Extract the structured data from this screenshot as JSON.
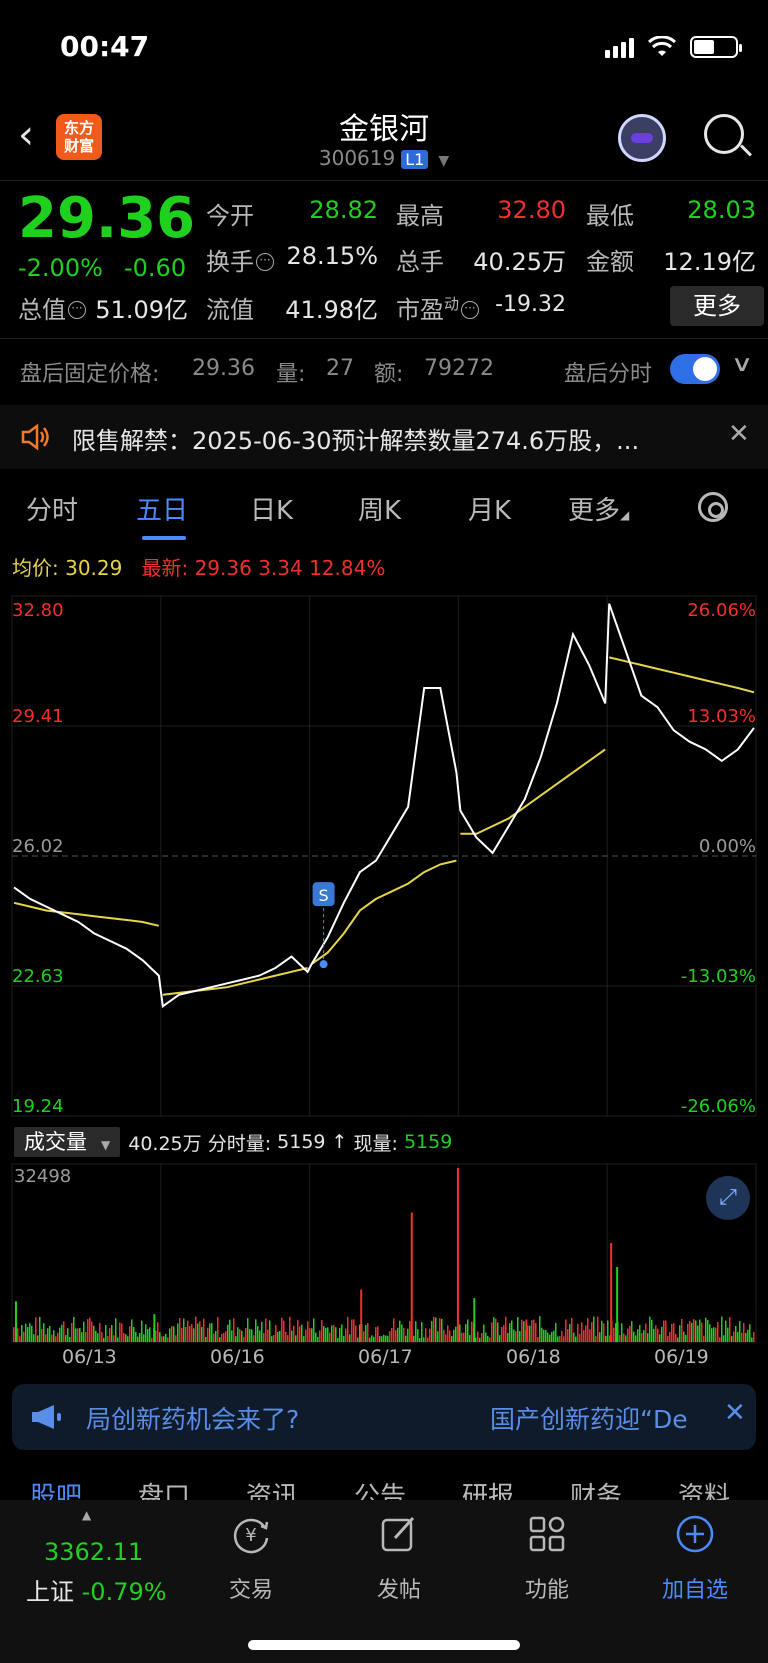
{
  "status_bar": {
    "time": "00:47"
  },
  "header": {
    "stock_name": "金银河",
    "stock_code": "300619",
    "level_badge": "L1"
  },
  "quote": {
    "price": "29.36",
    "change_pct": "-2.00%",
    "change": "-0.60",
    "open_label": "今开",
    "open": "28.82",
    "high_label": "最高",
    "high": "32.80",
    "low_label": "最低",
    "low": "28.03",
    "turnover_label": "换手",
    "turnover": "28.15%",
    "volume_label": "总手",
    "volume": "40.25万",
    "amount_label": "金额",
    "amount": "12.19亿",
    "mktcap_label": "总值",
    "mktcap": "51.09亿",
    "float_label": "流值",
    "float_cap": "41.98亿",
    "pe_label": "市盈",
    "pe_sup": "动",
    "pe": "-19.32",
    "more_label": "更多"
  },
  "after_hours": {
    "label": "盘后固定价格:",
    "price": "29.36",
    "vol_label": "量:",
    "vol": "27",
    "amt_label": "额:",
    "amt": "79272",
    "intraday_label": "盘后分时"
  },
  "notice": {
    "text": "限售解禁：2025-06-30预计解禁数量274.6万股，..."
  },
  "tabs": [
    "分时",
    "五日",
    "日K",
    "周K",
    "月K",
    "更多"
  ],
  "active_tab": "五日",
  "legend": {
    "avg_label": "均价:",
    "avg": "30.29",
    "latest_label": "最新:",
    "latest": "29.36",
    "latest_change": "3.34",
    "latest_pct": "12.84%"
  },
  "colors": {
    "up": "#f0302c",
    "down": "#1fd01f",
    "accent": "#4a8cff",
    "avg_line": "#e8d44a"
  },
  "chart_data": {
    "type": "line",
    "title": "",
    "xlabel": "",
    "ylabel": "",
    "x": [
      "06/13",
      "06/16",
      "06/17",
      "06/18",
      "06/19"
    ],
    "y_ticks_left": [
      "32.80",
      "29.41",
      "26.02",
      "22.63",
      "19.24"
    ],
    "y_ticks_right": [
      "26.06%",
      "13.03%",
      "0.00%",
      "-13.03%",
      "-26.06%"
    ],
    "ylim": [
      19.24,
      32.8
    ],
    "prev_close": 26.02,
    "series": [
      {
        "values": [
          [
            25.2,
            24.9,
            24.7,
            24.5,
            24.3,
            24.0,
            23.8,
            23.6,
            23.3,
            22.9
          ],
          [
            22.1,
            22.4,
            22.5,
            22.6,
            22.7,
            22.8,
            22.9,
            23.1,
            23.4,
            23.0
          ],
          [
            23.2,
            23.9,
            24.8,
            25.6,
            25.9,
            26.6,
            27.3,
            30.4,
            30.4,
            28.2
          ],
          [
            27.2,
            26.5,
            26.1,
            26.8,
            27.5,
            28.6,
            30.0,
            31.8,
            31.0,
            30.0
          ],
          [
            32.6,
            31.4,
            30.2,
            29.9,
            29.3,
            29.0,
            28.8,
            28.5,
            28.8,
            29.36
          ]
        ]
      },
      {
        "values": [
          [
            24.8,
            24.7,
            24.6,
            24.55,
            24.5,
            24.45,
            24.4,
            24.35,
            24.3,
            24.2
          ],
          [
            22.4,
            22.45,
            22.5,
            22.55,
            22.6,
            22.7,
            22.8,
            22.9,
            23.0,
            23.1
          ],
          [
            23.2,
            23.5,
            24.0,
            24.6,
            24.9,
            25.1,
            25.3,
            25.6,
            25.8,
            25.9
          ],
          [
            26.6,
            26.6,
            26.8,
            27.0,
            27.3,
            27.6,
            27.9,
            28.2,
            28.5,
            28.8
          ],
          [
            31.2,
            31.1,
            31.0,
            30.9,
            30.8,
            30.7,
            30.6,
            30.5,
            30.4,
            30.29
          ]
        ]
      }
    ],
    "volume": {
      "label": "成交量",
      "total": "40.25万",
      "minute_label": "分时量:",
      "minute_value": "5159",
      "arrow": "↑",
      "current_label": "现量:",
      "current_value": "5159",
      "y_max_label": "32498",
      "y_max": 32498,
      "peaks": [
        {
          "day": 0,
          "pos": 0.02,
          "value": 7600,
          "dir": "down"
        },
        {
          "day": 0,
          "pos": 0.95,
          "value": 5200,
          "dir": "down"
        },
        {
          "day": 2,
          "pos": 0.34,
          "value": 9800,
          "dir": "up"
        },
        {
          "day": 2,
          "pos": 0.68,
          "value": 24200,
          "dir": "up"
        },
        {
          "day": 2,
          "pos": 0.99,
          "value": 32498,
          "dir": "up"
        },
        {
          "day": 3,
          "pos": 0.1,
          "value": 8200,
          "dir": "down"
        },
        {
          "day": 3,
          "pos": 0.45,
          "value": 4200,
          "dir": "up"
        },
        {
          "day": 4,
          "pos": 0.02,
          "value": 18500,
          "dir": "up"
        },
        {
          "day": 4,
          "pos": 0.06,
          "value": 14000,
          "dir": "down"
        }
      ]
    }
  },
  "banner": {
    "text": "局创新药机会来了?",
    "text2": "国产创新药迎“De"
  },
  "sub_tabs": [
    "股吧",
    "盘口",
    "资讯",
    "公告",
    "研报",
    "财务",
    "资料"
  ],
  "bottom_bar": {
    "index_value": "3362.11",
    "index_name": "上证",
    "index_pct": "-0.79%",
    "items": [
      {
        "label": "交易",
        "icon": "trade-icon"
      },
      {
        "label": "发帖",
        "icon": "post-icon"
      },
      {
        "label": "功能",
        "icon": "functions-icon"
      },
      {
        "label": "加自选",
        "icon": "add-watchlist-icon"
      }
    ]
  }
}
